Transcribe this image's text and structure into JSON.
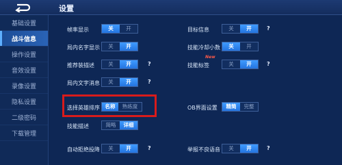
{
  "header": {
    "title": "设置"
  },
  "sidebar": {
    "items": [
      {
        "label": "基础设置",
        "active": false
      },
      {
        "label": "战斗信息",
        "active": true
      },
      {
        "label": "操作设置",
        "active": false
      },
      {
        "label": "音效设置",
        "active": false
      },
      {
        "label": "录像设置",
        "active": false
      },
      {
        "label": "隐私设置",
        "active": false
      },
      {
        "label": "二级密码",
        "active": false
      },
      {
        "label": "下载管理",
        "active": false
      }
    ]
  },
  "settings": {
    "frame_rate": {
      "label": "帧率显示",
      "options": [
        "关",
        "开"
      ],
      "selected": "关"
    },
    "target_info": {
      "label": "目标信息",
      "options": [
        "关",
        "开"
      ],
      "selected": "开",
      "help": "?"
    },
    "in_game_name": {
      "label": "局内名字显示",
      "options": [
        "关",
        "开"
      ],
      "selected": "开"
    },
    "skill_cd_decimal": {
      "label": "技能冷却小数",
      "options": [
        "关",
        "开"
      ],
      "selected": "关"
    },
    "recommended_gear": {
      "label": "推荐装描述",
      "options": [
        "关",
        "开"
      ],
      "selected": "开",
      "help": "?"
    },
    "skill_tag": {
      "label": "技能标签",
      "badge": "New",
      "options": [
        "关",
        "开"
      ],
      "selected": "开",
      "help": "?"
    },
    "in_game_text": {
      "label": "局内文字消息",
      "options": [
        "关",
        "开"
      ],
      "selected": "开",
      "help": "?"
    },
    "hero_sort": {
      "label": "选择英雄排序",
      "options": [
        "名称",
        "熟练度"
      ],
      "selected": "名称"
    },
    "ob_ui": {
      "label": "OB界面设置",
      "options": [
        "精简",
        "完整"
      ],
      "selected": "精简"
    },
    "skill_desc": {
      "label": "技能描述",
      "options": [
        "简略",
        "详细"
      ],
      "selected": "详细"
    },
    "auto_reject_surrender": {
      "label": "自动拒绝投降",
      "options": [
        "关",
        "开"
      ],
      "selected": "开",
      "help": "?"
    },
    "report_voice": {
      "label": "举报不良语音",
      "options": [
        "关",
        "开"
      ],
      "selected": "开",
      "help": "?"
    }
  }
}
